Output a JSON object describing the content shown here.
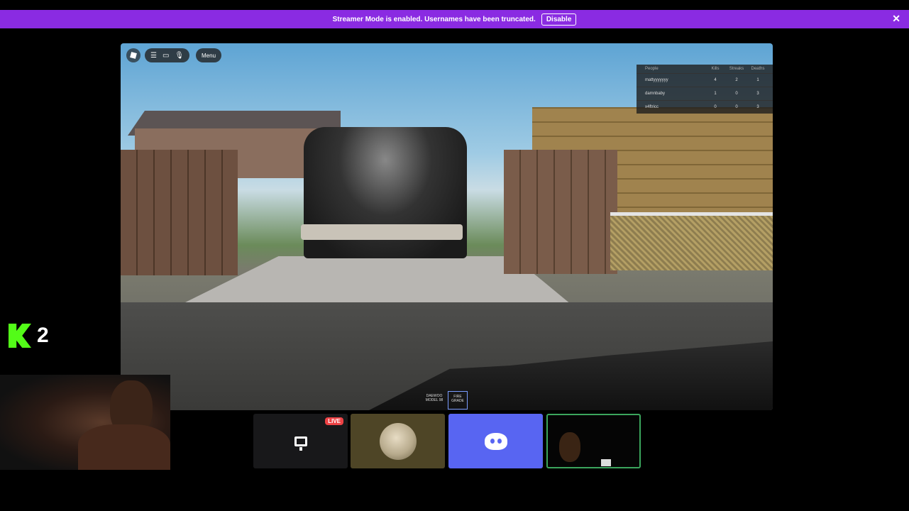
{
  "banner": {
    "message": "Streamer Mode is enabled. Usernames have been truncated.",
    "disable_label": "Disable",
    "close_glyph": "✕"
  },
  "roblox": {
    "menu_label": "Menu",
    "icons": [
      "roblox-logo-icon",
      "hamburger-icon",
      "chat-icon",
      "microphone-icon"
    ],
    "players": {
      "header": [
        "People",
        "Kills",
        "Streaks",
        "Deaths"
      ],
      "rows": [
        {
          "name": "mattyyyyyyy",
          "kills": "4",
          "streaks": "2",
          "deaths": "1"
        },
        {
          "name": "damnbaby",
          "kills": "1",
          "streaks": "0",
          "deaths": "3"
        },
        {
          "name": "x4ftricc",
          "kills": "0",
          "streaks": "0",
          "deaths": "3"
        }
      ]
    },
    "hotbar": [
      {
        "label": "DAEWOO MODEL 98"
      },
      {
        "label": "FIRE GRADE"
      }
    ]
  },
  "kick": {
    "viewer_count": "2",
    "accent": "#53fc18"
  },
  "call_tiles": {
    "live_badge": "LIVE",
    "discord_color": "#5865f2",
    "speaking_border": "#3ba55d"
  },
  "colors": {
    "banner": "#8a2be2",
    "live": "#ed4245"
  }
}
